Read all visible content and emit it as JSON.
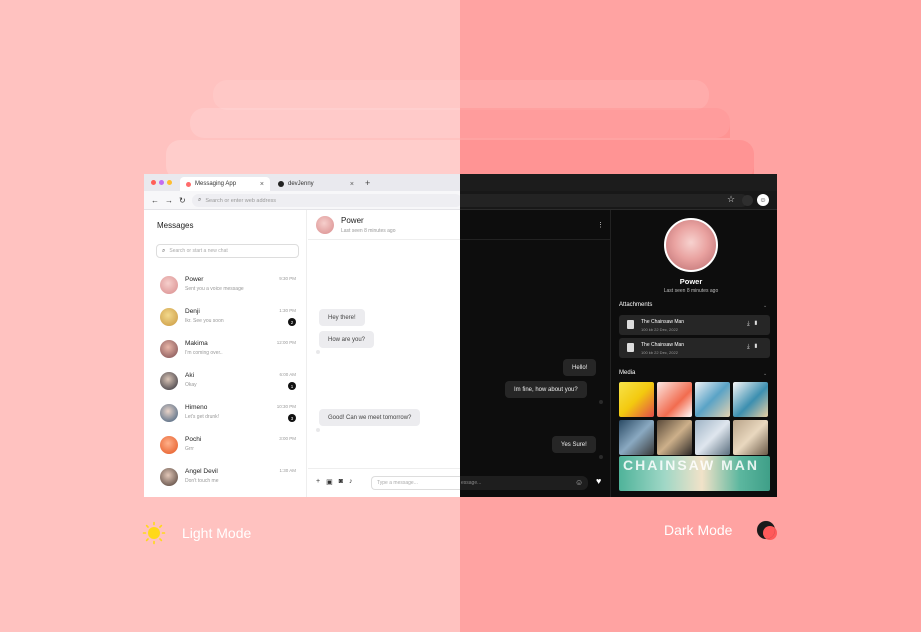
{
  "browser": {
    "tab_active_title": "Messaging App",
    "tab2_title": "devJenny",
    "address_placeholder": "Search or enter web address"
  },
  "sidebar": {
    "title": "Messages",
    "search_placeholder": "Search or start a new chat",
    "chats": [
      {
        "name": "Power",
        "preview": "Sent you a voice message",
        "time": "9:30 PM",
        "badge": ""
      },
      {
        "name": "Denji",
        "preview": "Ikr. See you soon",
        "time": "1:30 PM",
        "badge": "2"
      },
      {
        "name": "Makima",
        "preview": "I'm coming over..",
        "time": "12:00 PM",
        "badge": ""
      },
      {
        "name": "Aki",
        "preview": "Okay",
        "time": "6:00 AM",
        "badge": "1"
      },
      {
        "name": "Himeno",
        "preview": "Let's get drunk!",
        "time": "10:30 PM",
        "badge": "3"
      },
      {
        "name": "Pochi",
        "preview": "Grrr",
        "time": "3:00 PM",
        "badge": ""
      },
      {
        "name": "Angel Devil",
        "preview": "Don't touch me",
        "time": "1:30 AM",
        "badge": ""
      }
    ]
  },
  "conversation": {
    "contact_name": "Power",
    "last_seen": "Last seen 8 minutes ago",
    "messages": [
      {
        "text": "Hey there!",
        "side": "received"
      },
      {
        "text": "How are you?",
        "side": "received"
      },
      {
        "text": "Hello!",
        "side": "sent"
      },
      {
        "text": "Im fine, how about you?",
        "side": "sent"
      },
      {
        "text": "Good! Can we meet tomorrow?",
        "side": "received"
      },
      {
        "text": "Yes Sure!",
        "side": "sent"
      }
    ],
    "input_placeholder": "Type a message...",
    "dark_input_fragment": "essage..."
  },
  "profile": {
    "name": "Power",
    "last_seen": "Last seen 8 minutes ago",
    "attachments_label": "Attachments",
    "attachments": [
      {
        "name": "The Chainsaw Man",
        "meta": "100 kb    22 Dec, 2022"
      },
      {
        "name": "The Chainsaw Man",
        "meta": "100 kb    22 Dec, 2022"
      }
    ],
    "media_label": "Media",
    "media_banner_text": "CHAINSAW MAN"
  },
  "modes": {
    "light_label": "Light Mode",
    "dark_label": "Dark Mode"
  },
  "colors": {
    "background_light_half": "#ffc2c0",
    "background_dark_half": "#ffa3a2",
    "dark_panel": "#0d0d0d"
  }
}
